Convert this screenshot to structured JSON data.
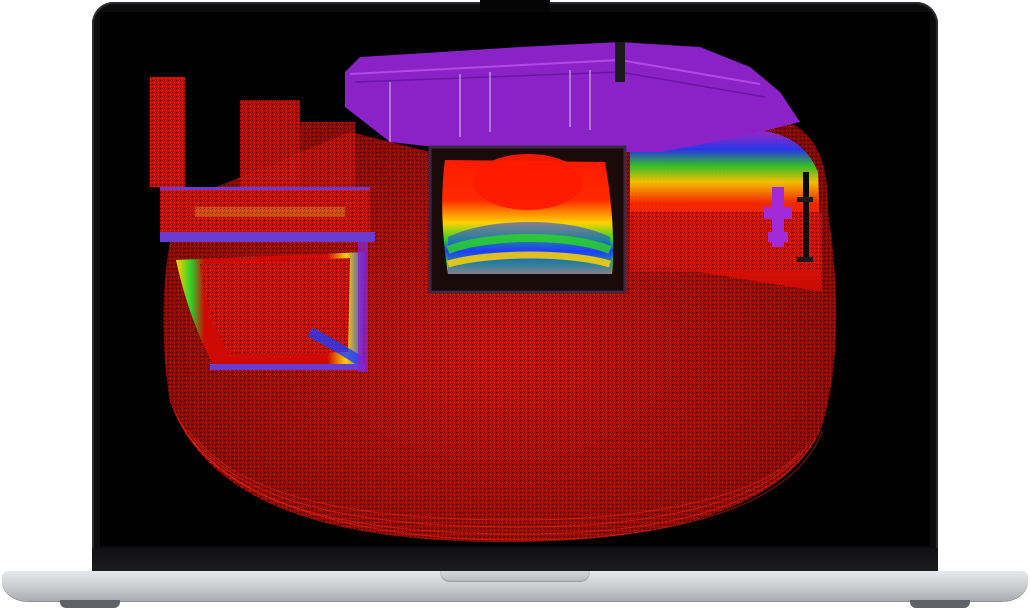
{
  "device": {
    "type": "laptop",
    "finish_color": "#c9cbcf",
    "bezel_color": "#0b0b0c"
  },
  "screen": {
    "content": "point-cloud-heatmap",
    "background": "#000000",
    "palette": [
      "#d10000",
      "#ff2a00",
      "#ffd200",
      "#2bd12b",
      "#1e3cff",
      "#7a1fb4",
      "#a22ad8"
    ]
  }
}
